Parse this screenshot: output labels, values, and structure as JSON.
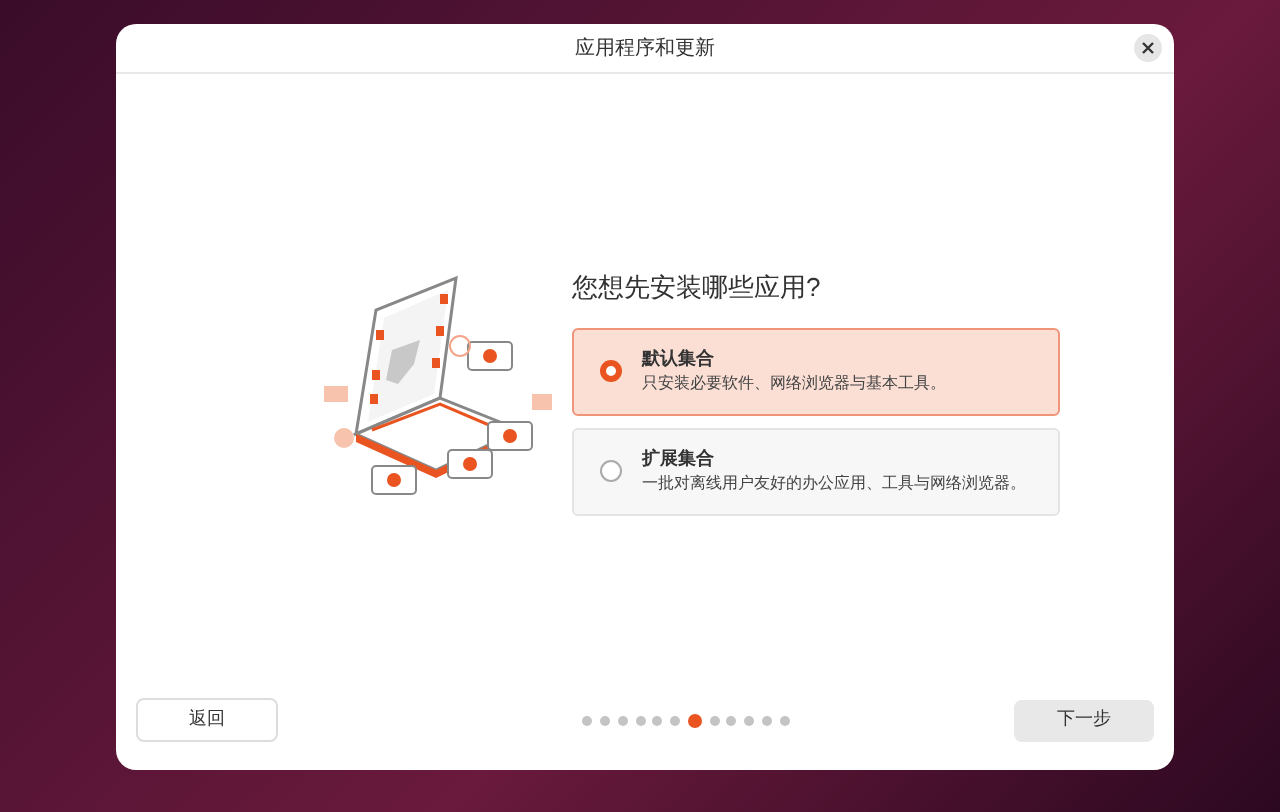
{
  "window": {
    "title": "应用程序和更新"
  },
  "question": "您想先安装哪些应用?",
  "options": [
    {
      "title": "默认集合",
      "description": "只安装必要软件、网络浏览器与基本工具。",
      "selected": true
    },
    {
      "title": "扩展集合",
      "description": "一批对离线用户友好的办公应用、工具与网络浏览器。",
      "selected": false
    }
  ],
  "back_button": "返回",
  "next_button": "下一步",
  "steps": [
    {
      "selected": false
    },
    {
      "selected": false
    },
    {
      "selected": false
    },
    {
      "selected": false
    },
    {
      "selected": false
    },
    {
      "selected": false
    },
    {
      "selected": true
    },
    {
      "selected": false
    },
    {
      "selected": false
    },
    {
      "selected": false
    },
    {
      "selected": false
    },
    {
      "selected": false
    }
  ]
}
